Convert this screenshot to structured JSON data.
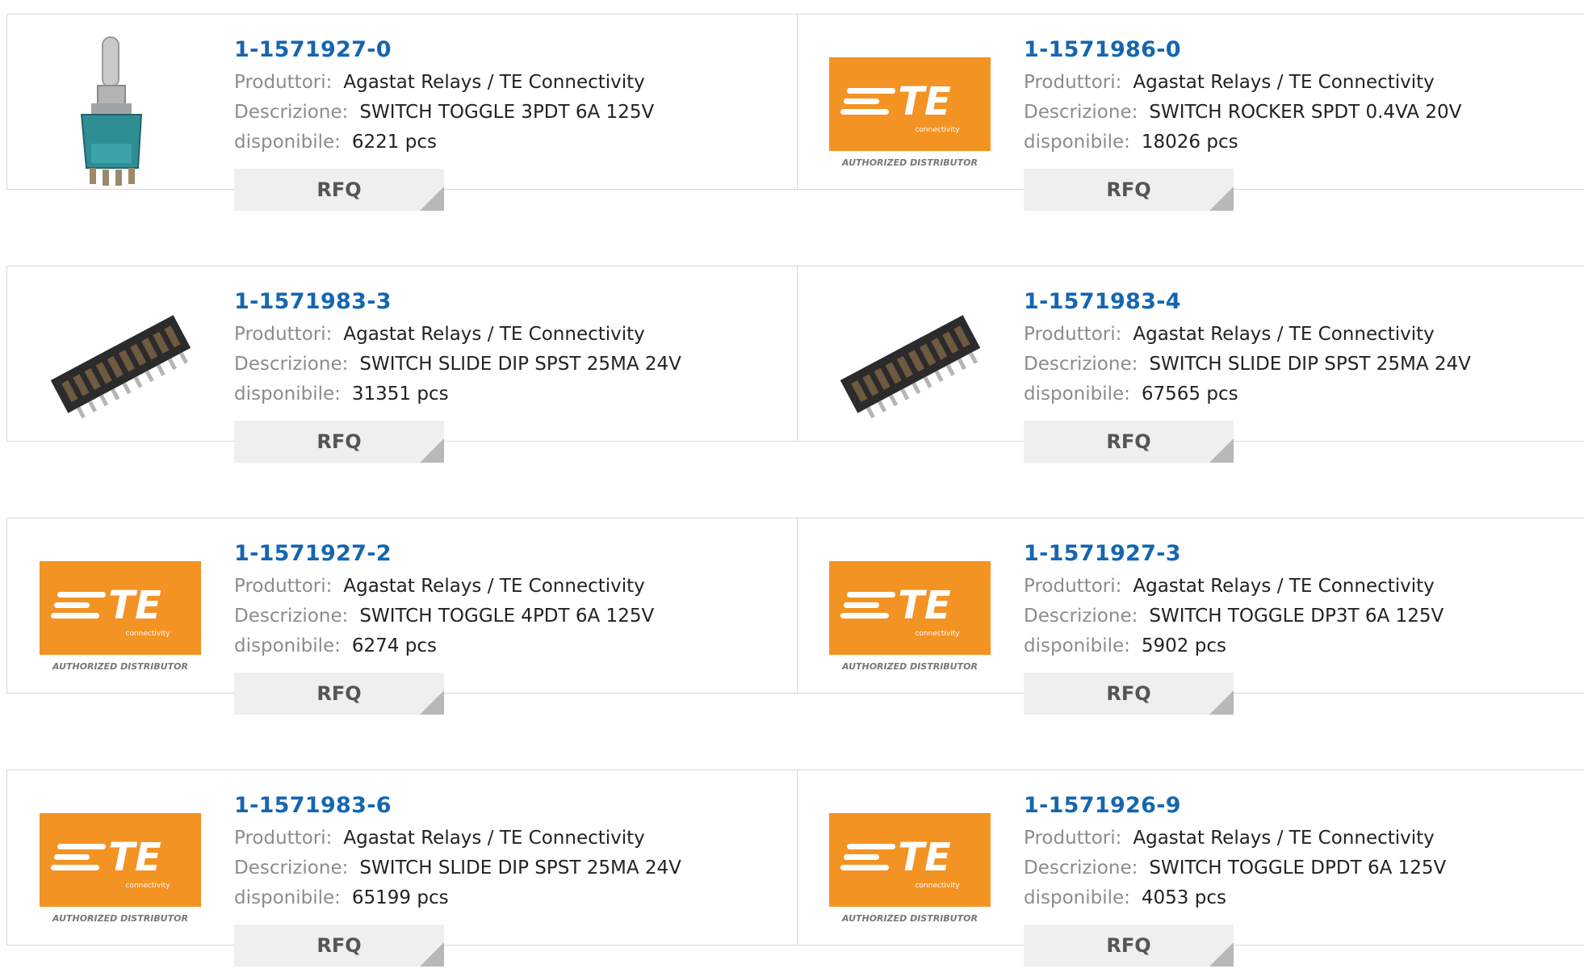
{
  "labels": {
    "manufacturer": "Produttori:",
    "description": "Descrizione:",
    "available": "disponibile:",
    "rfq": "RFQ"
  },
  "logo": {
    "brand": "TE",
    "sub": "connectivity",
    "badge": "AUTHORIZED DISTRIBUTOR",
    "color": "#f39324"
  },
  "colors": {
    "part_link": "#1566b0",
    "label_gray": "#8c8c8c",
    "rfq_bg": "#efefef"
  },
  "products": [
    {
      "part": "1-1571927-0",
      "manufacturer": "Agastat Relays / TE Connectivity",
      "description": "SWITCH TOGGLE 3PDT 6A 125V",
      "stock": "6221 pcs",
      "image": "toggle-switch"
    },
    {
      "part": "1-1571986-0",
      "manufacturer": "Agastat Relays / TE Connectivity",
      "description": "SWITCH ROCKER SPDT 0.4VA 20V",
      "stock": "18026 pcs",
      "image": "te-logo"
    },
    {
      "part": "1-1571983-3",
      "manufacturer": "Agastat Relays / TE Connectivity",
      "description": "SWITCH SLIDE DIP SPST 25MA 24V",
      "stock": "31351 pcs",
      "image": "dip-switch"
    },
    {
      "part": "1-1571983-4",
      "manufacturer": "Agastat Relays / TE Connectivity",
      "description": "SWITCH SLIDE DIP SPST 25MA 24V",
      "stock": "67565 pcs",
      "image": "dip-switch"
    },
    {
      "part": "1-1571927-2",
      "manufacturer": "Agastat Relays / TE Connectivity",
      "description": "SWITCH TOGGLE 4PDT 6A 125V",
      "stock": "6274 pcs",
      "image": "te-logo"
    },
    {
      "part": "1-1571927-3",
      "manufacturer": "Agastat Relays / TE Connectivity",
      "description": "SWITCH TOGGLE DP3T 6A 125V",
      "stock": "5902 pcs",
      "image": "te-logo"
    },
    {
      "part": "1-1571983-6",
      "manufacturer": "Agastat Relays / TE Connectivity",
      "description": "SWITCH SLIDE DIP SPST 25MA 24V",
      "stock": "65199 pcs",
      "image": "te-logo"
    },
    {
      "part": "1-1571926-9",
      "manufacturer": "Agastat Relays / TE Connectivity",
      "description": "SWITCH TOGGLE DPDT 6A 125V",
      "stock": "4053 pcs",
      "image": "te-logo"
    }
  ]
}
